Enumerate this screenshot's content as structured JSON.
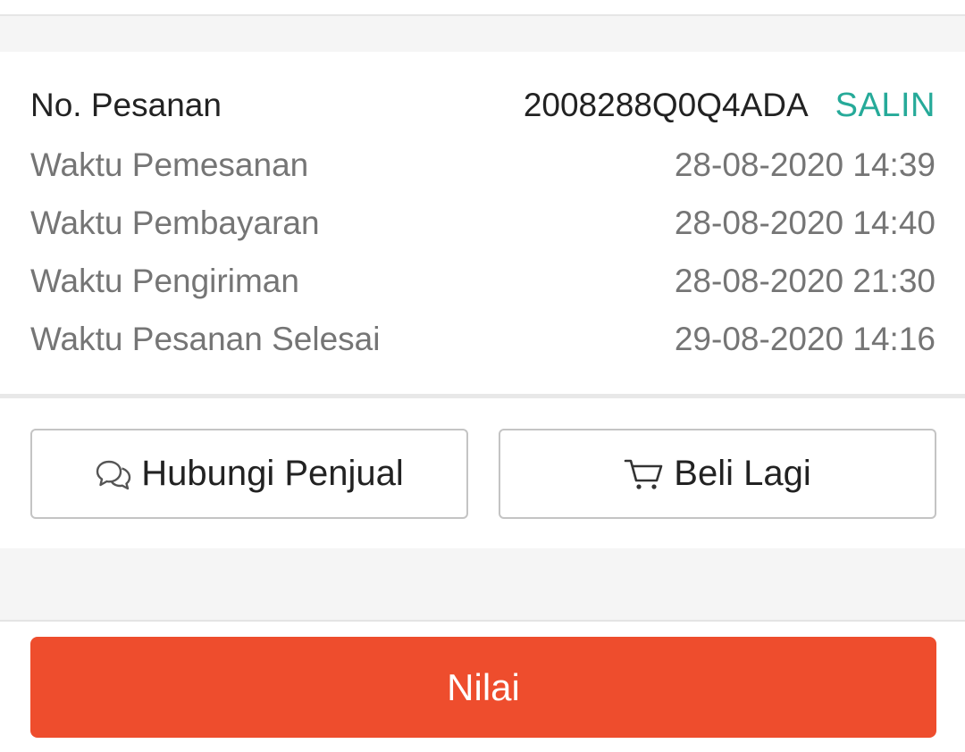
{
  "order_info": {
    "order_no_label": "No. Pesanan",
    "order_no_value": "2008288Q0Q4ADA",
    "copy_label": "SALIN",
    "rows": [
      {
        "label": "Waktu Pemesanan",
        "value": "28-08-2020 14:39"
      },
      {
        "label": "Waktu Pembayaran",
        "value": "28-08-2020 14:40"
      },
      {
        "label": "Waktu Pengiriman",
        "value": "28-08-2020 21:30"
      },
      {
        "label": "Waktu Pesanan Selesai",
        "value": "29-08-2020 14:16"
      }
    ]
  },
  "actions": {
    "chat_seller_label": "Hubungi Penjual",
    "chat_icon": "chat-bubbles-icon",
    "buy_again_label": "Beli Lagi",
    "buy_again_icon": "shopping-cart-icon"
  },
  "footer": {
    "rate_label": "Nilai"
  },
  "colors": {
    "accent_orange": "#ee4d2d",
    "copy_teal": "#26aa99",
    "background_gray": "#f5f5f5"
  }
}
